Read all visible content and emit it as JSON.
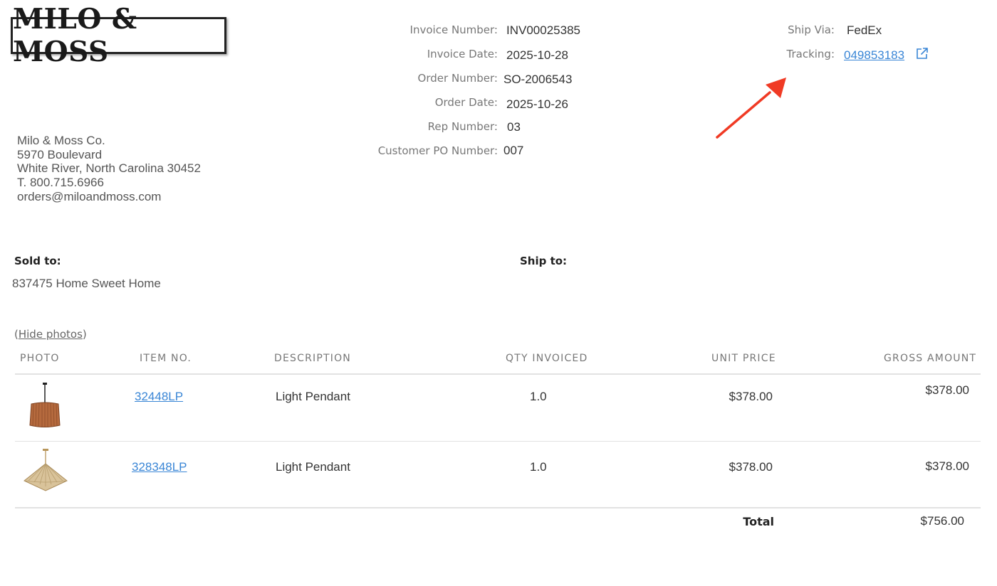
{
  "brand": {
    "logo_text": "MILO & MOSS"
  },
  "invoice_meta": {
    "invoice_number_label": "Invoice Number:",
    "invoice_number": "INV00025385",
    "invoice_date_label": "Invoice Date:",
    "invoice_date": "2025-10-28",
    "order_number_label": "Order Number:",
    "order_number": "SO-2006543",
    "order_date_label": "Order Date:",
    "order_date": "2025-10-26",
    "rep_number_label": "Rep Number:",
    "rep_number": "03",
    "customer_po_label": "Customer PO Number:",
    "customer_po": "007"
  },
  "shipping": {
    "ship_via_label": "Ship Via:",
    "ship_via": "FedEx",
    "tracking_label": "Tracking:",
    "tracking_number": "049853183",
    "external_link_icon": "external-link-icon"
  },
  "annotation": {
    "arrow_color": "#f03a24"
  },
  "company": {
    "name": "Milo & Moss Co.",
    "street": "5970 Boulevard",
    "city_state_zip": "White River, North Carolina 30452",
    "phone": "T. 800.715.6966",
    "email": "orders@miloandmoss.com"
  },
  "parties": {
    "sold_to_label": "Sold to:",
    "sold_to_value": "837475 Home Sweet Home",
    "ship_to_label": "Ship to:"
  },
  "photos_toggle": {
    "open_paren": "(",
    "label": "Hide photos",
    "close_paren": ")"
  },
  "table": {
    "columns": [
      "PHOTO",
      "ITEM NO.",
      "DESCRIPTION",
      "QTY INVOICED",
      "UNIT PRICE",
      "GROSS AMOUNT"
    ],
    "rows": [
      {
        "photo_icon": "drum-pendant-light-photo",
        "item_no": "32448LP",
        "description": "Light Pendant",
        "qty": "1.0",
        "unit_price": "$378.00",
        "gross_amount": "$378.00"
      },
      {
        "photo_icon": "saucer-pendant-light-photo",
        "item_no": "328348LP",
        "description": "Light Pendant",
        "qty": "1.0",
        "unit_price": "$378.00",
        "gross_amount": "$378.00"
      }
    ],
    "total_label": "Total",
    "total_value": "$756.00"
  },
  "colors": {
    "link": "#3a86d6",
    "label_gray": "#777777",
    "text": "#333333"
  }
}
